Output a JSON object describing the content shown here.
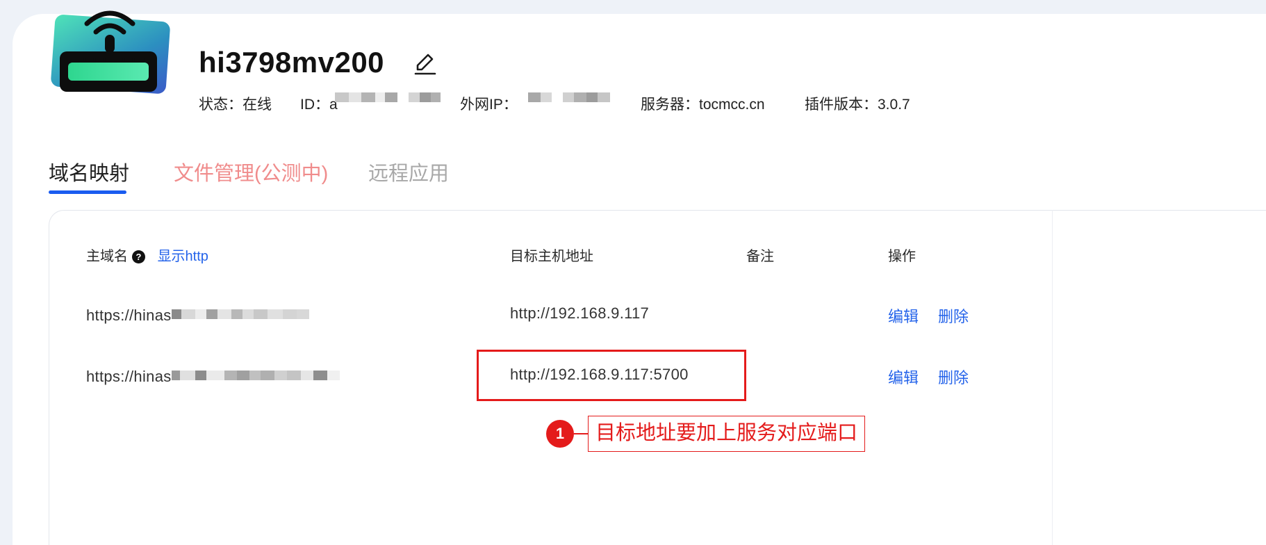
{
  "device": {
    "name": "hi3798mv200",
    "status_label": "状态：在线",
    "id_label": "ID：",
    "id_partial": "a",
    "wan_ip_label": "外网IP：",
    "server_label": "服务器：tocmcc.cn",
    "plugin_version_label": "插件版本：3.0.7"
  },
  "tabs": [
    {
      "label": "域名映射",
      "state": "active"
    },
    {
      "label": "文件管理(公测中)",
      "state": "highlighted"
    },
    {
      "label": "远程应用",
      "state": "inactive"
    }
  ],
  "table": {
    "headers": {
      "domain": "主域名",
      "show_http": "显示http",
      "target": "目标主机地址",
      "note": "备注",
      "actions": "操作"
    },
    "rows": [
      {
        "domain_prefix": "https://hinas",
        "target": "http://192.168.9.117",
        "note": "",
        "edit": "编辑",
        "delete": "删除"
      },
      {
        "domain_prefix": "https://hinas",
        "target": "http://192.168.9.117:5700",
        "note": "",
        "edit": "编辑",
        "delete": "删除"
      }
    ]
  },
  "annotation": {
    "number": "1",
    "text": "目标地址要加上服务对应端口",
    "color": "#e41b1b"
  },
  "colors": {
    "accent": "#1a5cf0",
    "link": "#2463ea",
    "tab_highlight": "#f08c8c",
    "tab_inactive": "#a8a8a8"
  },
  "icons": {
    "device": "router-icon",
    "edit": "pencil-edit-icon",
    "help": "question-circle-icon"
  }
}
